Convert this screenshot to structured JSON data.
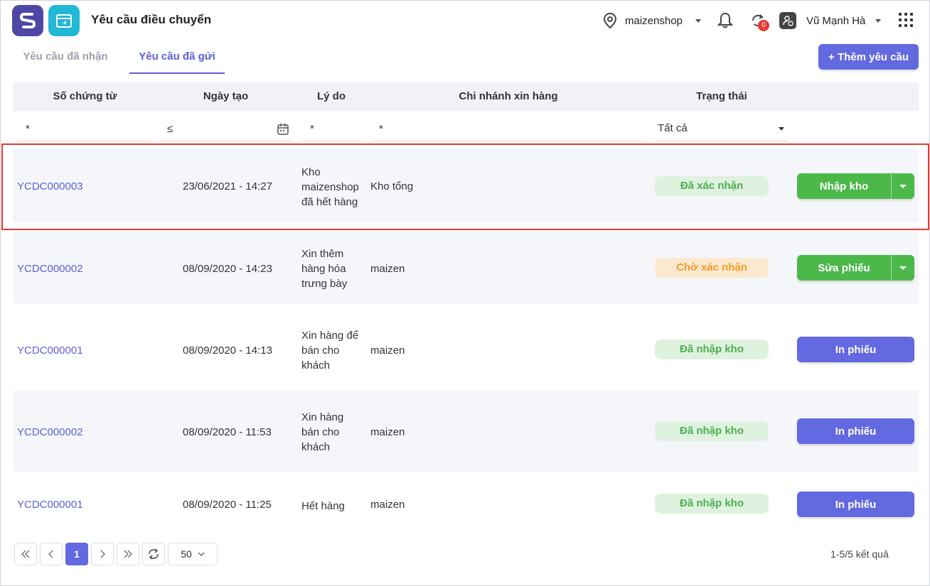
{
  "app": {
    "title": "Yêu cầu điều chuyển"
  },
  "header": {
    "store": "maizenshop",
    "notification_count": "0",
    "user": "Vũ Mạnh Hà"
  },
  "tabs": [
    {
      "label": "Yêu cầu đã nhận",
      "active": false
    },
    {
      "label": "Yêu cầu đã gửi",
      "active": true
    }
  ],
  "add_button": "+ Thêm yêu cầu",
  "columns": [
    "Số chứng từ",
    "Ngày tạo",
    "Lý do",
    "Chi nhánh xin hàng",
    "Trạng thái"
  ],
  "filters": {
    "code": "*",
    "date": "≤",
    "reason": "*",
    "branch": "*",
    "status": "Tất cả"
  },
  "rows": [
    {
      "code": "YCDC000003",
      "date": "23/06/2021 - 14:27",
      "reason": "Kho maizenshop đã hết hàng",
      "branch": "Kho tổng",
      "status": "Đã xác nhận",
      "action": "Nhập kho"
    },
    {
      "code": "YCDC000002",
      "date": "08/09/2020 - 14:23",
      "reason": "Xin thêm hàng hóa trưng bày",
      "branch": "maizen",
      "status": "Chờ xác nhận",
      "action": "Sửa phiếu"
    },
    {
      "code": "YCDC000001",
      "date": "08/09/2020 - 14:13",
      "reason": "Xin hàng để bán cho khách",
      "branch": "maizen",
      "status": "Đã nhập kho",
      "action": "In phiếu"
    },
    {
      "code": "YCDC000002",
      "date": "08/09/2020 - 11:53",
      "reason": "Xin hàng bán cho khách",
      "branch": "maizen",
      "status": "Đã nhập kho",
      "action": "In phiếu"
    },
    {
      "code": "YCDC000001",
      "date": "08/09/2020 - 11:25",
      "reason": "Hết hàng",
      "branch": "maizen",
      "status": "Đã nhập kho",
      "action": "In phiếu"
    }
  ],
  "pagination": {
    "current_page": "1",
    "page_size": "50",
    "summary": "1-5/5 kết quả"
  },
  "colors": {
    "accent": "#6369e0",
    "success": "#4cb84a",
    "warning": "#f59a23",
    "highlight": "#e53935"
  }
}
